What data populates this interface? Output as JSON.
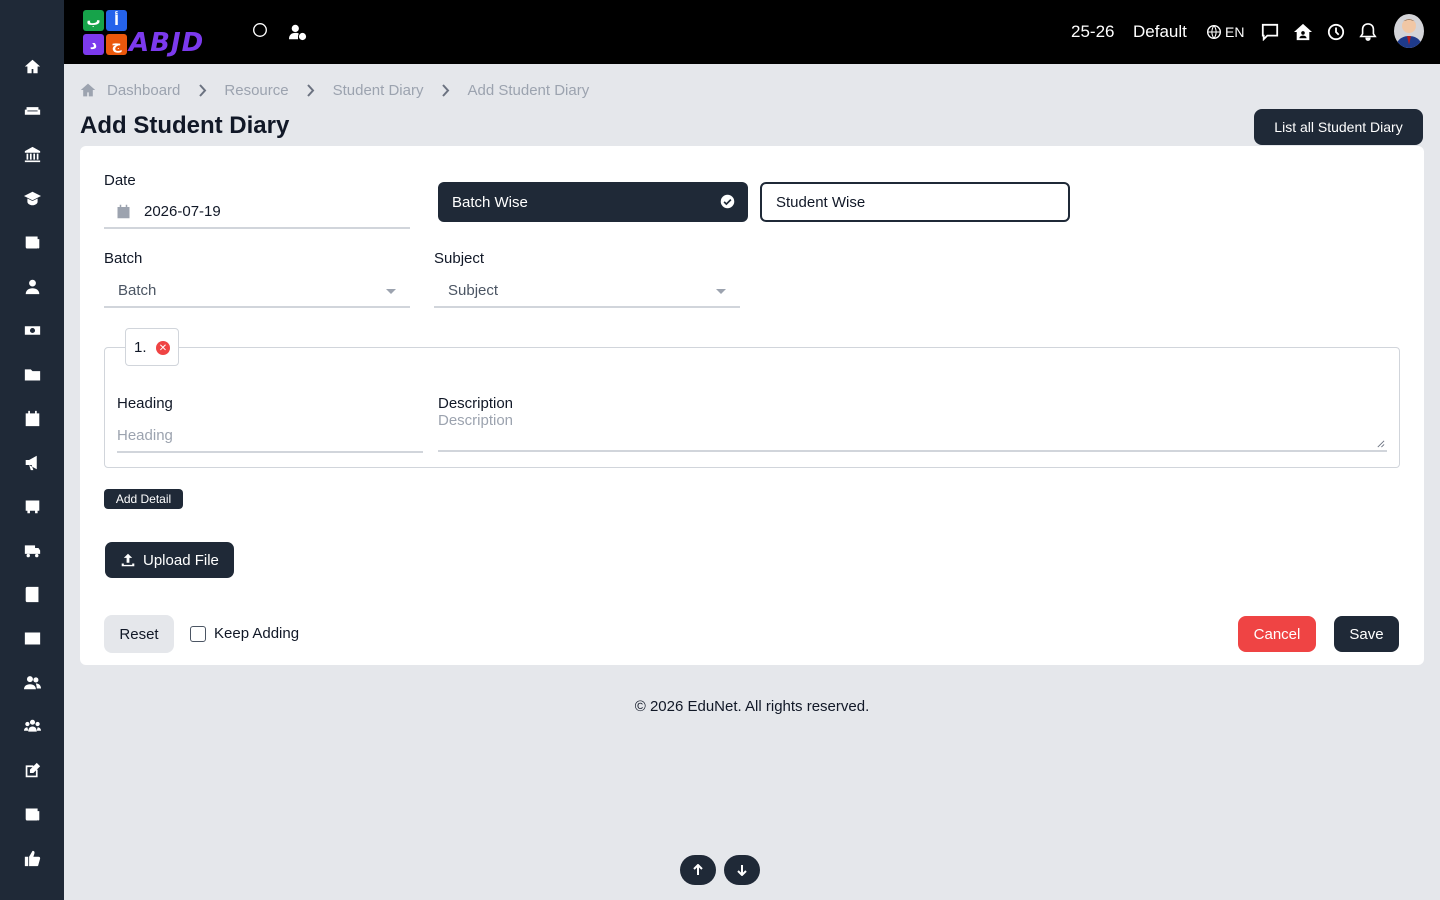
{
  "topbar": {
    "logo_text": "ABJD",
    "session": "25-26",
    "profile": "Default",
    "language": "EN"
  },
  "breadcrumb": [
    "Dashboard",
    "Resource",
    "Student Diary",
    "Add Student Diary"
  ],
  "page": {
    "title": "Add Student Diary",
    "list_button": "List all Student Diary"
  },
  "form": {
    "date_label": "Date",
    "date_value": "2026-07-19",
    "mode_options": [
      "Batch Wise",
      "Student Wise"
    ],
    "selected_mode": "Batch Wise",
    "batch_label": "Batch",
    "batch_placeholder": "Batch",
    "subject_label": "Subject",
    "subject_placeholder": "Subject",
    "detail_index": "1.",
    "heading_label": "Heading",
    "heading_placeholder": "Heading",
    "description_label": "Description",
    "description_placeholder": "Description",
    "add_detail": "Add Detail",
    "upload_file": "Upload File",
    "reset": "Reset",
    "keep_adding": "Keep Adding",
    "keep_adding_checked": false,
    "cancel": "Cancel",
    "save": "Save"
  },
  "footer": "© 2026 EduNet. All rights reserved.",
  "sidebar_icons": [
    "home-icon",
    "sofa-icon",
    "bank-icon",
    "graduation-icon",
    "news-icon",
    "user-icon",
    "money-icon",
    "folder-icon",
    "calendar-icon",
    "megaphone-icon",
    "bus-icon",
    "truck-icon",
    "book-icon",
    "image-icon",
    "users-icon",
    "group-icon",
    "edit-icon",
    "newspaper-icon",
    "thumbs-up-icon"
  ],
  "colors": {
    "primary": "#1f2937",
    "danger": "#ef4444",
    "background": "#e5e7eb"
  }
}
